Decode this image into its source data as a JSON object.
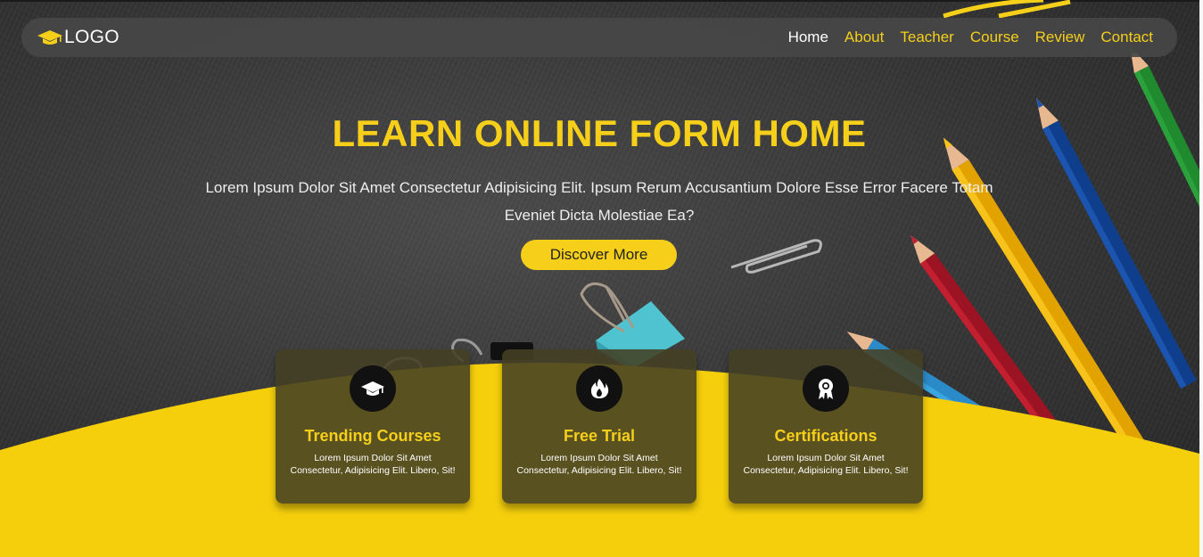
{
  "nav": {
    "logo_icon": "graduation-cap-icon",
    "logo_text": "LOGO",
    "links": [
      {
        "label": "Home"
      },
      {
        "label": "About"
      },
      {
        "label": "Teacher"
      },
      {
        "label": "Course"
      },
      {
        "label": "Review"
      },
      {
        "label": "Contact"
      }
    ],
    "active_link": "Home"
  },
  "hero": {
    "title": "LEARN ONLINE FORM HOME",
    "description": "Lorem Ipsum Dolor Sit Amet Consectetur Adipisicing Elit. Ipsum Rerum Accusantium Dolore Esse Error Facere Totam Eveniet Dicta Molestiae Ea?",
    "button_label": "Discover More"
  },
  "features": [
    {
      "icon": "graduation-cap-icon",
      "title": "Trending Courses",
      "text": "Lorem Ipsum Dolor Sit Amet Consectetur, Adipisicing Elit. Libero, Sit!"
    },
    {
      "icon": "fire-icon",
      "title": "Free Trial",
      "text": "Lorem Ipsum Dolor Sit Amet Consectetur, Adipisicing Elit. Libero, Sit!"
    },
    {
      "icon": "award-icon",
      "title": "Certifications",
      "text": "Lorem Ipsum Dolor Sit Amet Consectetur, Adipisicing Elit. Libero, Sit!"
    }
  ],
  "colors": {
    "accent": "#f5cf1a",
    "navbar_bg": "#464646",
    "card_bg": "#444024",
    "background": "#343434"
  }
}
